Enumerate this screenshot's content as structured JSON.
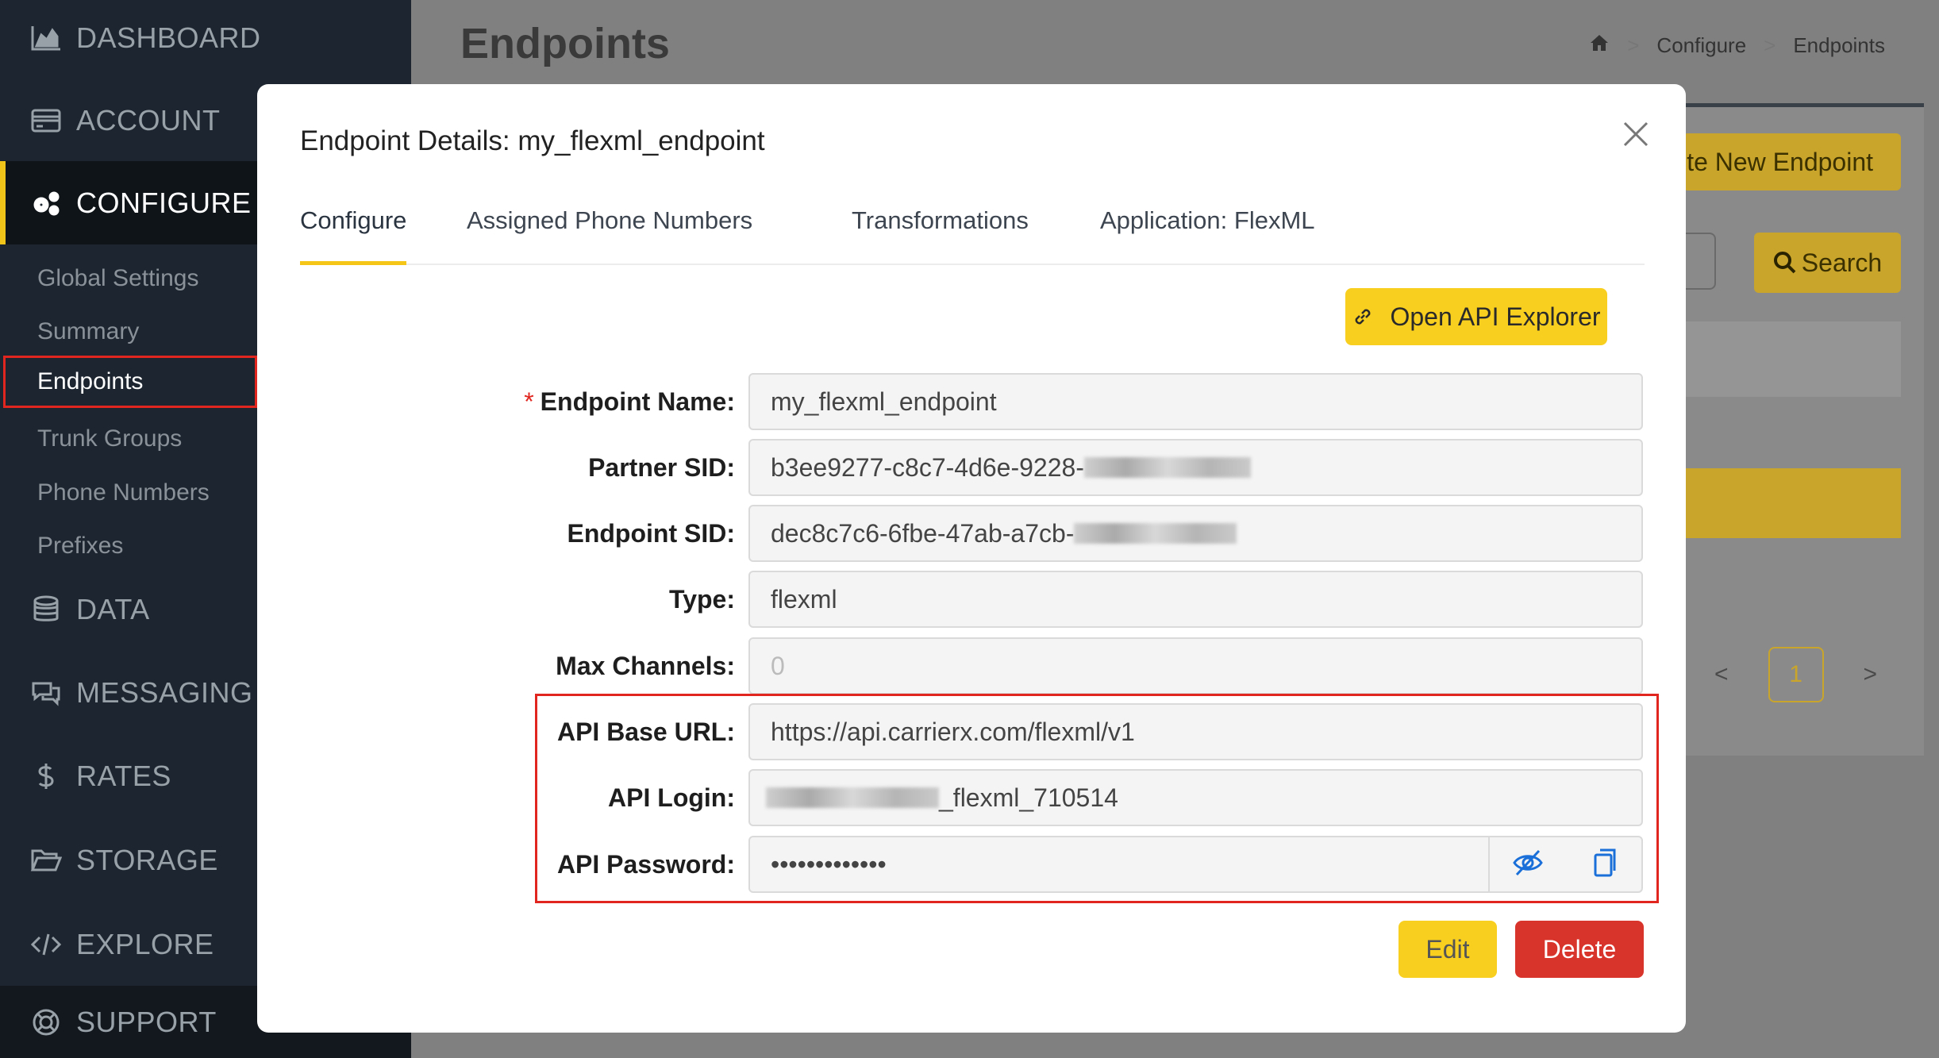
{
  "sidebar": {
    "items": [
      {
        "label": "DASHBOARD",
        "icon": "area-chart-icon"
      },
      {
        "label": "ACCOUNT",
        "icon": "credit-card-icon"
      },
      {
        "label": "CONFIGURE",
        "icon": "cogs-icon"
      },
      {
        "label": "DATA",
        "icon": "database-icon"
      },
      {
        "label": "MESSAGING",
        "icon": "chat-bubbles-icon"
      },
      {
        "label": "RATES",
        "icon": "dollar-icon"
      },
      {
        "label": "STORAGE",
        "icon": "folder-open-icon"
      },
      {
        "label": "EXPLORE",
        "icon": "code-icon"
      },
      {
        "label": "SUPPORT",
        "icon": "life-ring-icon"
      }
    ],
    "submenu": [
      "Global Settings",
      "Summary",
      "Endpoints",
      "Trunk Groups",
      "Phone Numbers",
      "Prefixes"
    ]
  },
  "page": {
    "title": "Endpoints",
    "breadcrumb": [
      "Configure",
      "Endpoints"
    ],
    "create_button": "te New Endpoint",
    "search_button": "Search",
    "pager": {
      "prev": "<",
      "current": "1",
      "next": ">"
    }
  },
  "modal": {
    "title": "Endpoint Details: my_flexml_endpoint",
    "tabs": [
      "Configure",
      "Assigned Phone Numbers",
      "Transformations",
      "Application: FlexML"
    ],
    "api_explorer_label": "Open API Explorer",
    "fields": {
      "endpoint_name": {
        "label": "Endpoint Name",
        "value": "my_flexml_endpoint",
        "required": true
      },
      "partner_sid": {
        "label": "Partner SID",
        "value": "b3ee9277-c8c7-4d6e-9228-"
      },
      "endpoint_sid": {
        "label": "Endpoint SID",
        "value": "dec8c7c6-6fbe-47ab-a7cb-"
      },
      "type": {
        "label": "Type",
        "value": "flexml"
      },
      "max_channels": {
        "label": "Max Channels",
        "value": "0"
      },
      "api_base_url": {
        "label": "API Base URL",
        "value": "https://api.carrierx.com/flexml/v1"
      },
      "api_login": {
        "label": "API Login",
        "value": "_flexml_710514"
      },
      "api_password": {
        "label": "API Password",
        "value": "•••••••••••••"
      }
    },
    "edit_label": "Edit",
    "delete_label": "Delete"
  },
  "colors": {
    "accent": "#f8cf1f",
    "danger": "#d9342b",
    "sidebar_bg": "#1d2630",
    "link_icon": "#1a6fd8",
    "highlight": "#e0261f"
  }
}
